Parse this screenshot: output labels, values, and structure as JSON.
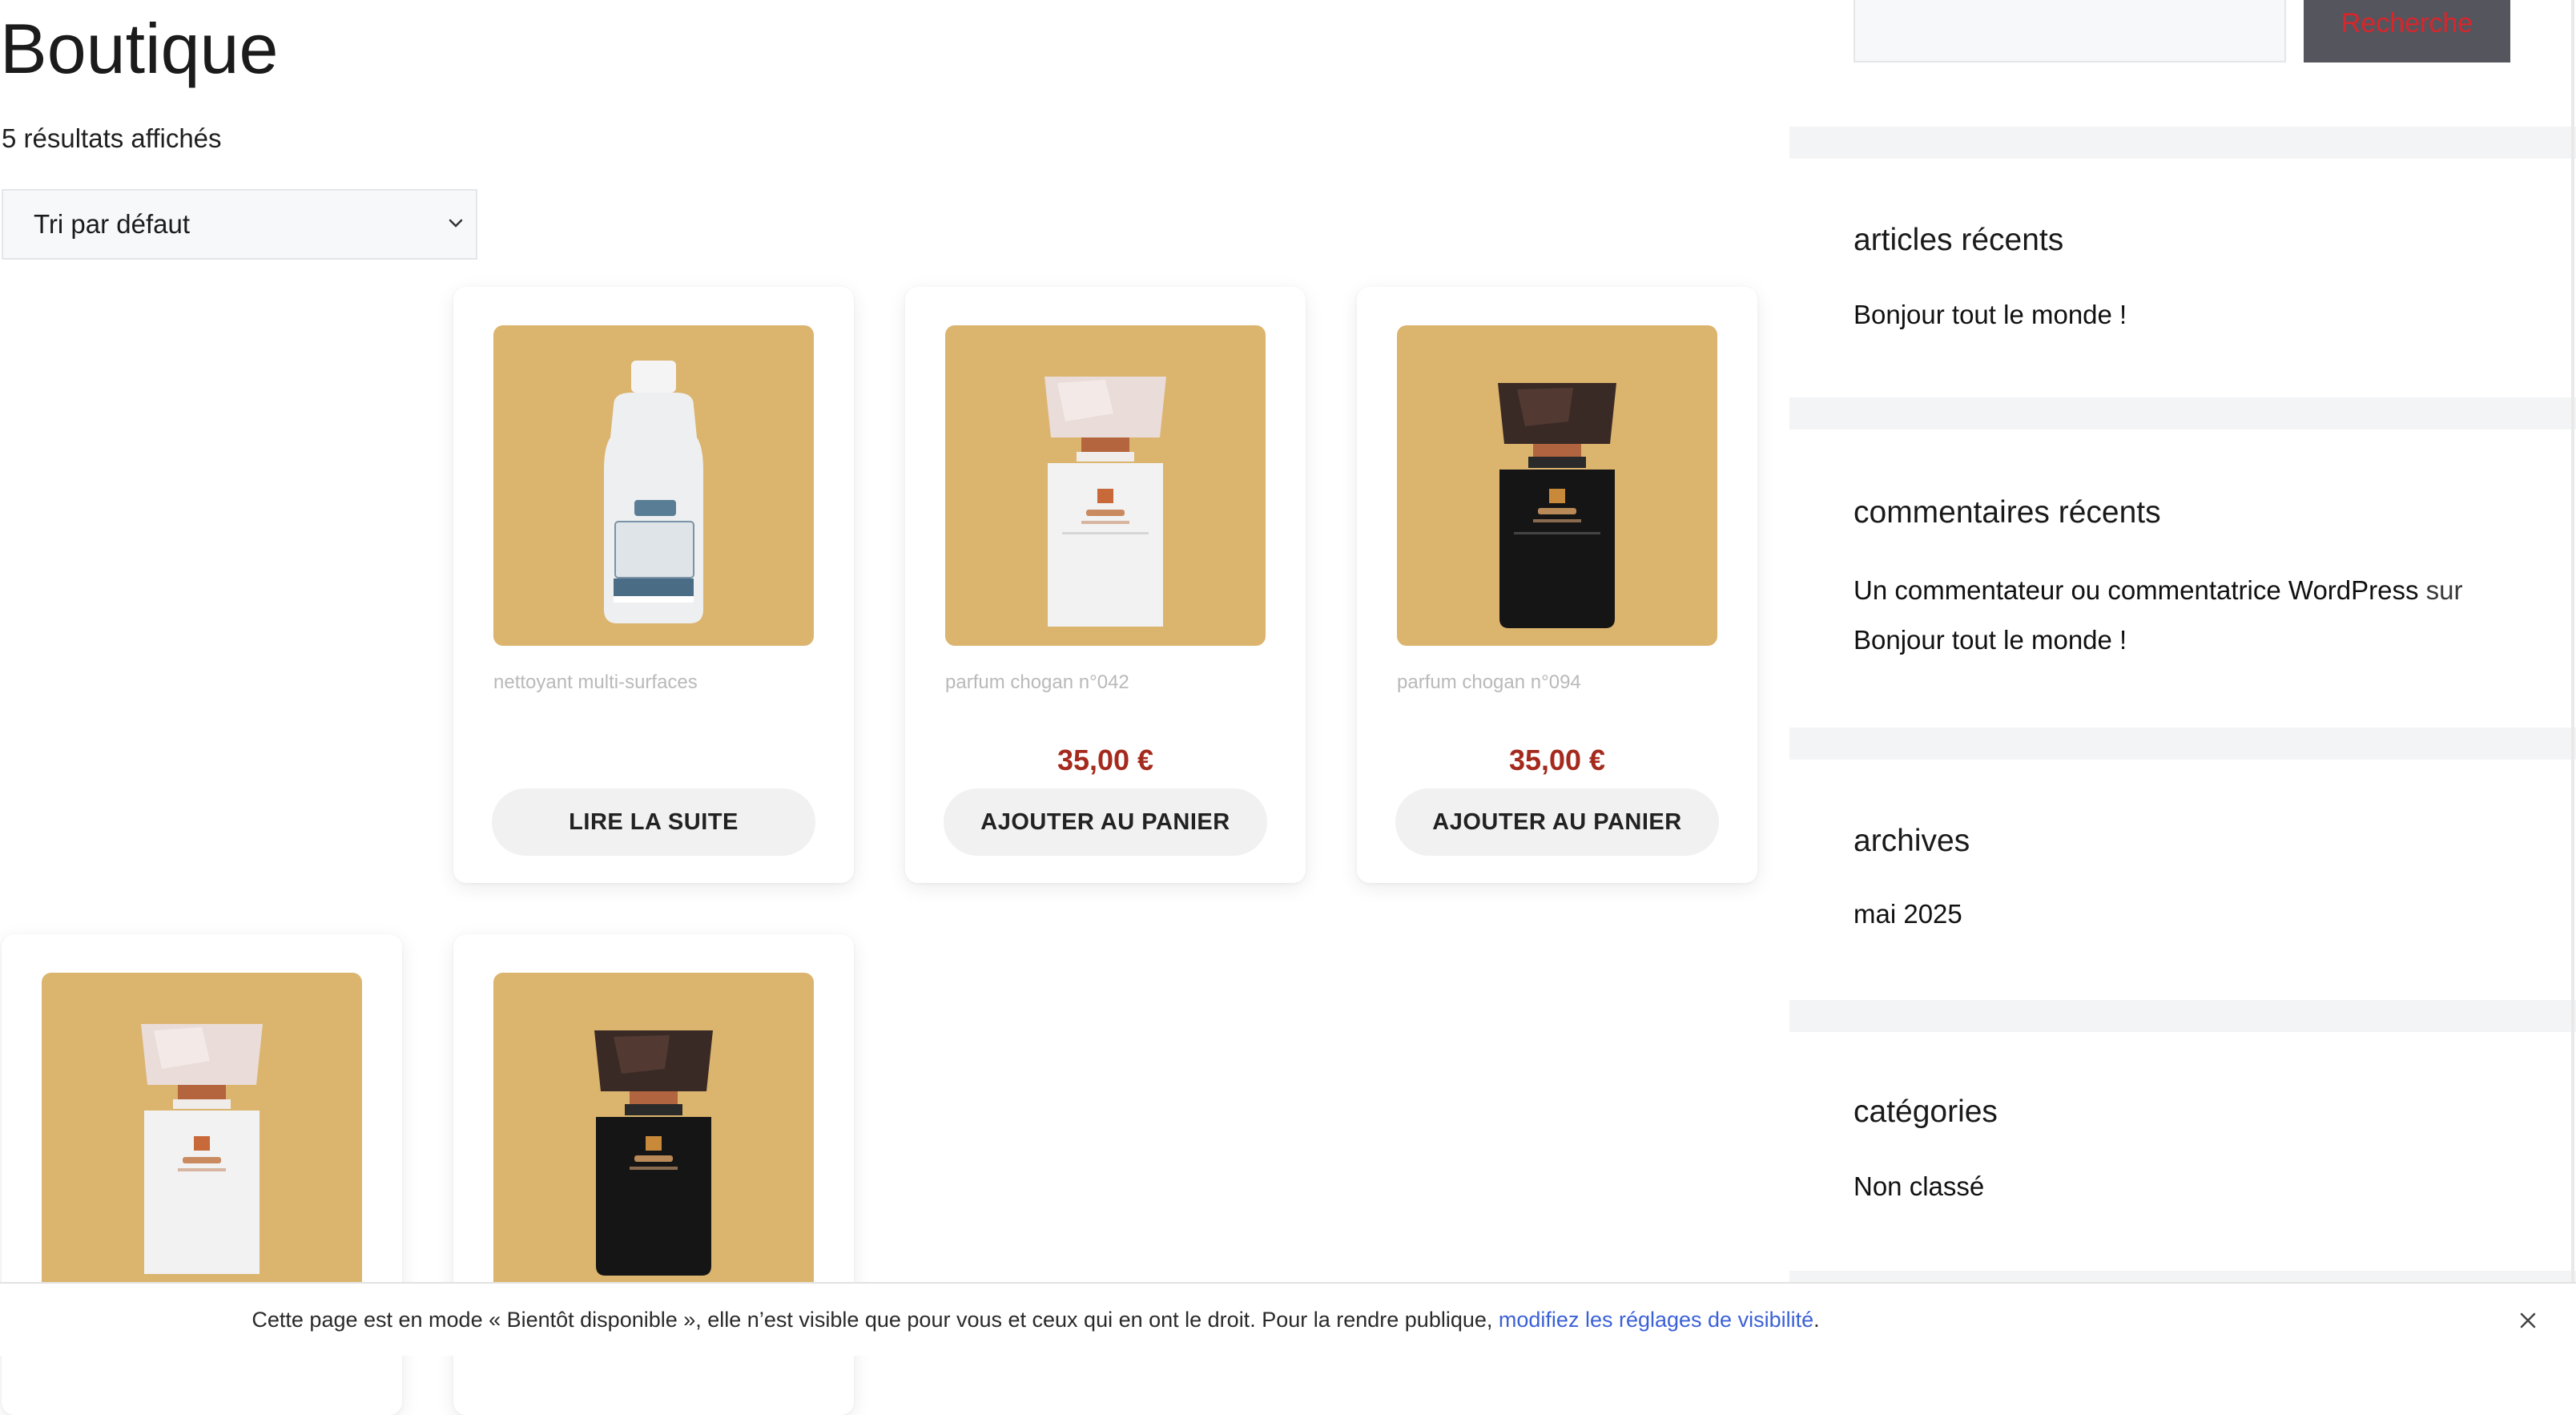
{
  "shop": {
    "title": "Boutique",
    "results_count": "5 résultats affichés",
    "sort_selected": "Tri par défaut"
  },
  "products": [
    {
      "name": "nettoyant multi-surfaces",
      "price": "",
      "button": "LIRE LA SUITE",
      "image_kind": "cleaner-bottle"
    },
    {
      "name": "parfum chogan n°042",
      "price": "35,00 €",
      "button": "AJOUTER AU PANIER",
      "image_kind": "white-perfume"
    },
    {
      "name": "parfum chogan n°094",
      "price": "35,00 €",
      "button": "AJOUTER AU PANIER",
      "image_kind": "black-perfume"
    },
    {
      "name": "",
      "price": "",
      "button": "",
      "image_kind": "white-perfume"
    },
    {
      "name": "",
      "price": "",
      "button": "",
      "image_kind": "black-perfume"
    }
  ],
  "sidebar": {
    "search_button": "Recherche",
    "search_placeholder": "",
    "recent_posts": {
      "title": "articles récents",
      "items": [
        "Bonjour tout le monde !"
      ]
    },
    "recent_comments": {
      "title": "commentaires récents",
      "author": "Un commentateur ou commentatrice WordPress",
      "on": "sur",
      "post": "Bonjour tout le monde !"
    },
    "archives": {
      "title": "archives",
      "items": [
        "mai 2025"
      ]
    },
    "categories": {
      "title": "catégories",
      "items": [
        "Non classé"
      ]
    }
  },
  "notice": {
    "text": "Cette page est en mode « Bientôt disponible », elle n’est visible que pour vous et ceux qui en ont le droit. Pour la rendre publique,",
    "link": "modifiez les réglages de visibilité",
    "suffix": "."
  },
  "colors": {
    "thumb_background": "#dbb46e",
    "price": "#a52a1e",
    "search_button_bg": "#55555e",
    "search_button_text": "#d8262b",
    "notice_link": "#3b61d6"
  },
  "icons": {
    "sort_chevron": "chevron-down-icon",
    "notice_close": "close-icon"
  }
}
